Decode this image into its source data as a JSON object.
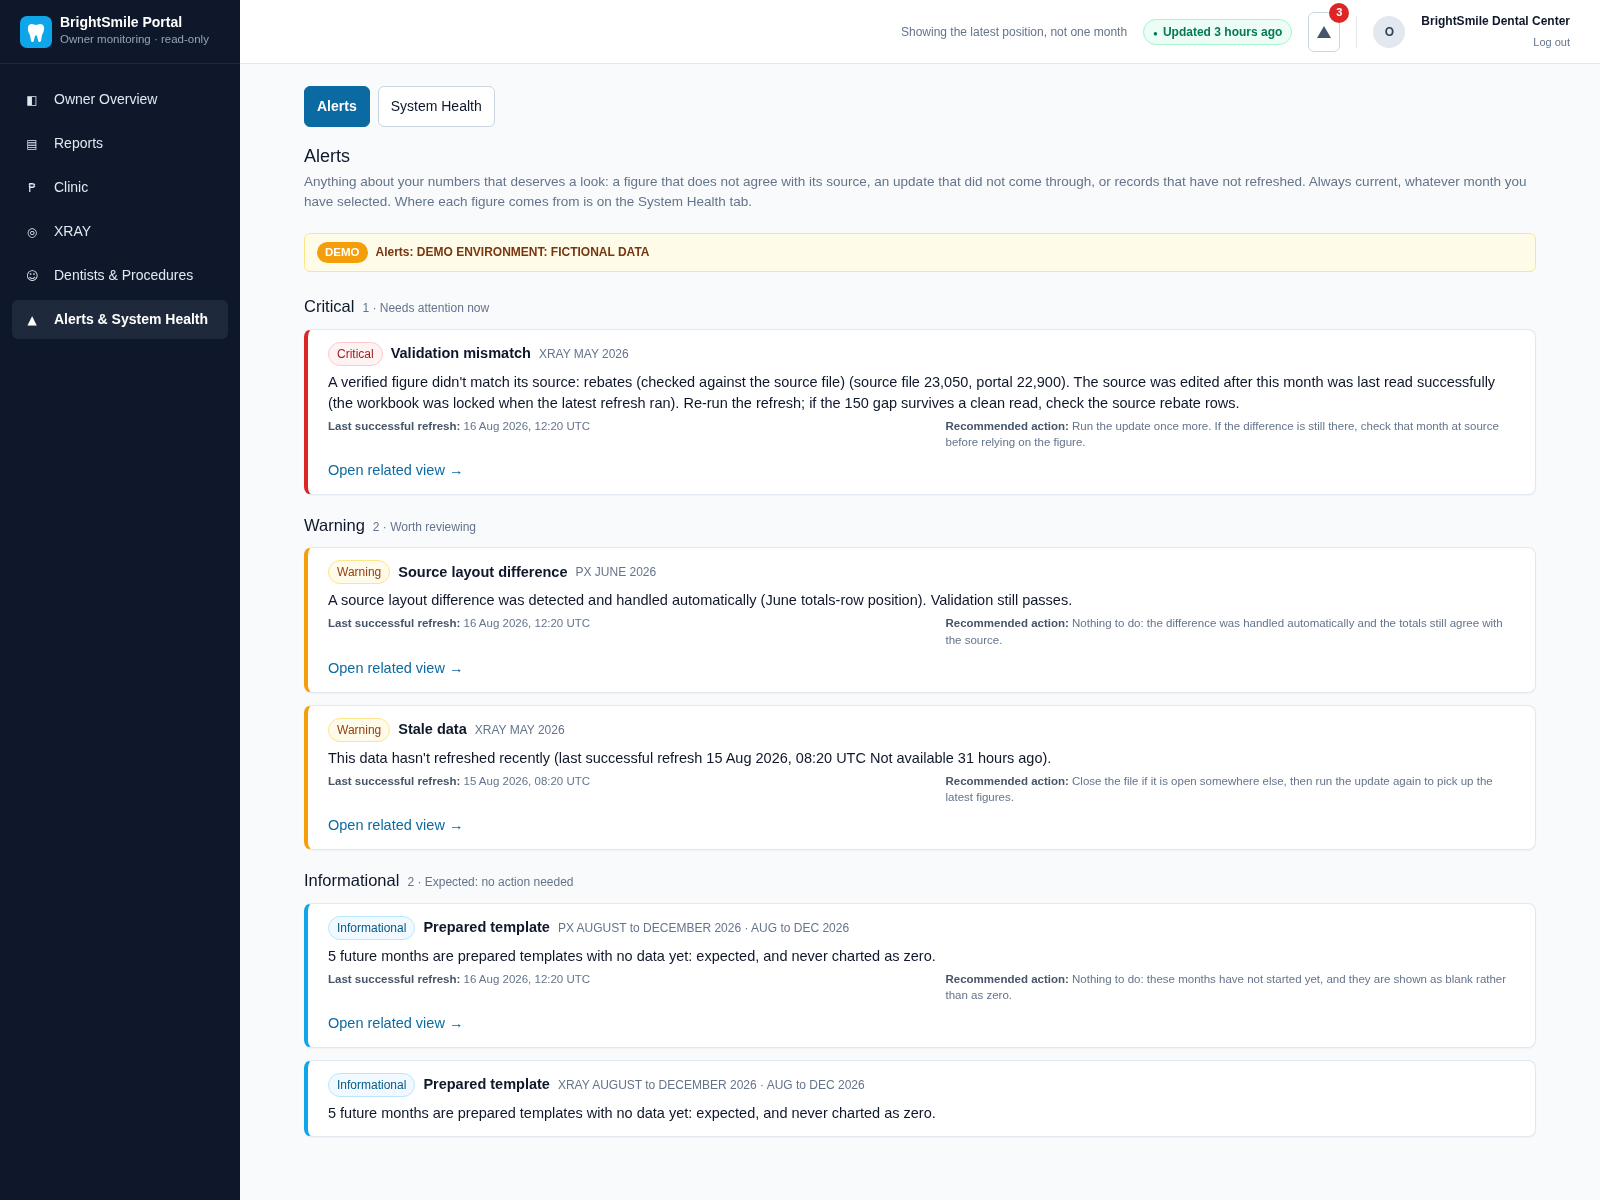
{
  "brand": {
    "title": "BrightSmile Portal",
    "subtitle": "Owner monitoring · read-only"
  },
  "sidebar": {
    "items": [
      {
        "glyph": "◧",
        "label": "Owner Overview",
        "selected": false
      },
      {
        "glyph": "▤",
        "label": "Reports",
        "selected": false
      },
      {
        "glyph": "₱",
        "label": "Clinic",
        "selected": false
      },
      {
        "glyph": "◎",
        "label": "XRAY",
        "selected": false
      },
      {
        "glyph": "☺",
        "label": "Dentists & Procedures",
        "selected": false
      },
      {
        "glyph": "▲",
        "label": "Alerts & System Health",
        "selected": true
      }
    ]
  },
  "header": {
    "scope_note": "Showing the latest position, not one month",
    "status_dot": "●",
    "status": "Updated 3 hours ago",
    "alert_count": "3",
    "avatar": "O",
    "account": "BrightSmile Dental Center",
    "logout": "Log out"
  },
  "tabs": [
    {
      "label": "Alerts",
      "selected": true
    },
    {
      "label": "System Health",
      "selected": false
    }
  ],
  "page": {
    "title": "Alerts",
    "description": "Anything about your numbers that deserves a look: a figure that does not agree with its source, an update that did not come through, or records that have not refreshed. Always current, whatever month you have selected. Where each figure comes from is on the System Health tab."
  },
  "banner": {
    "badge": "DEMO",
    "text": "Alerts: DEMO ENVIRONMENT: FICTIONAL DATA"
  },
  "sections": [
    {
      "title": "Critical",
      "count": "1 · Needs attention now",
      "alerts": [
        {
          "kind": "critical",
          "badge": "Critical",
          "title": "Validation mismatch",
          "scope": "XRAY MAY 2026",
          "body": "A verified figure didn't match its source: rebates (checked against the source file) (source file 23,050, portal 22,900). The source was edited after this month was last read successfully (the workbook was locked when the latest refresh ran). Re-run the refresh; if the 150 gap survives a clean read, check the source rebate rows.",
          "refresh_label": "Last successful refresh:",
          "refresh": "16 Aug 2026, 12:20 UTC",
          "action_label": "Recommended action:",
          "action": "Run the update once more. If the difference is still there, check that month at source before relying on the figure.",
          "link": "Open related view →"
        }
      ]
    },
    {
      "title": "Warning",
      "count": "2 · Worth reviewing",
      "alerts": [
        {
          "kind": "warning",
          "badge": "Warning",
          "title": "Source layout difference",
          "scope": "PX JUNE 2026",
          "body": "A source layout difference was detected and handled automatically (June totals-row position). Validation still passes.",
          "refresh_label": "Last successful refresh:",
          "refresh": "16 Aug 2026, 12:20 UTC",
          "action_label": "Recommended action:",
          "action": "Nothing to do: the difference was handled automatically and the totals still agree with the source.",
          "link": "Open related view →"
        },
        {
          "kind": "warning",
          "badge": "Warning",
          "title": "Stale data",
          "scope": "XRAY MAY 2026",
          "body": "This data hasn't refreshed recently (last successful refresh 15 Aug 2026, 08:20 UTC Not available 31 hours ago).",
          "refresh_label": "Last successful refresh:",
          "refresh": "15 Aug 2026, 08:20 UTC",
          "action_label": "Recommended action:",
          "action": "Close the file if it is open somewhere else, then run the update again to pick up the latest figures.",
          "link": "Open related view →"
        }
      ]
    },
    {
      "title": "Informational",
      "count": "2 · Expected: no action needed",
      "alerts": [
        {
          "kind": "info",
          "badge": "Informational",
          "title": "Prepared template",
          "scope": "PX AUGUST to DECEMBER 2026 · AUG to DEC 2026",
          "body": "5 future months are prepared templates with no data yet: expected, and never charted as zero.",
          "refresh_label": "Last successful refresh:",
          "refresh": "16 Aug 2026, 12:20 UTC",
          "action_label": "Recommended action:",
          "action": "Nothing to do: these months have not started yet, and they are shown as blank rather than as zero.",
          "link": "Open related view →"
        },
        {
          "kind": "info",
          "badge": "Informational",
          "title": "Prepared template",
          "scope": "XRAY AUGUST to DECEMBER 2026 · AUG to DEC 2026",
          "body": "5 future months are prepared templates with no data yet: expected, and never charted as zero."
        }
      ]
    }
  ]
}
